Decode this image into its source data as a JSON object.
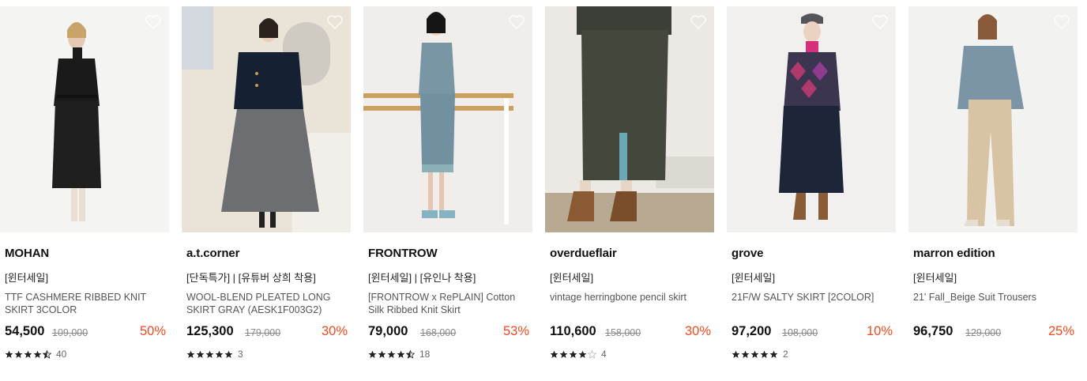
{
  "colors": {
    "discount": "#f04a1f",
    "star": "#222222",
    "star_empty": "#bbbbbb"
  },
  "products": [
    {
      "brand": "MOHAN",
      "tags": "[윈터세일]",
      "name": "TTF CASHMERE RIBBED KNIT SKIRT 3COLOR",
      "price": "54,500",
      "original_price": "109,000",
      "discount": "50%",
      "rating": 4.5,
      "review_count": "40",
      "photo_icon": "product-photo-black-knit-set"
    },
    {
      "brand": "a.t.corner",
      "tags": "[단독특가] | [유튜버 상희 착용]",
      "name": "WOOL-BLEND PLEATED LONG SKIRT GRAY (AESK1F003G2)",
      "price": "125,300",
      "original_price": "179,000",
      "discount": "30%",
      "rating": 5,
      "review_count": "3",
      "photo_icon": "product-photo-navy-coat-gray-skirt"
    },
    {
      "brand": "FRONTROW",
      "tags": "[윈터세일] | [유인나 착용]",
      "name": "[FRONTROW x RePLAIN] Cotton Silk Ribbed Knit Skirt",
      "price": "79,000",
      "original_price": "168,000",
      "discount": "53%",
      "rating": 4.5,
      "review_count": "18",
      "photo_icon": "product-photo-blue-ribbed-knit"
    },
    {
      "brand": "overdueflair",
      "tags": "[윈터세일]",
      "name": "vintage herringbone pencil skirt",
      "price": "110,600",
      "original_price": "158,000",
      "discount": "30%",
      "rating": 4,
      "review_count": "4",
      "photo_icon": "product-photo-herringbone-skirt-boots"
    },
    {
      "brand": "grove",
      "tags": "[윈터세일]",
      "name": "21F/W SALTY SKIRT [2COLOR]",
      "price": "97,200",
      "original_price": "108,000",
      "discount": "10%",
      "rating": 5,
      "review_count": "2",
      "photo_icon": "product-photo-argyle-sweater-navy-skirt"
    },
    {
      "brand": "marron edition",
      "tags": "[윈터세일]",
      "name": "21' Fall_Beige Suit Trousers",
      "price": "96,750",
      "original_price": "129,000",
      "discount": "25%",
      "rating": 0,
      "review_count": "",
      "photo_icon": "product-photo-beige-trousers"
    }
  ]
}
